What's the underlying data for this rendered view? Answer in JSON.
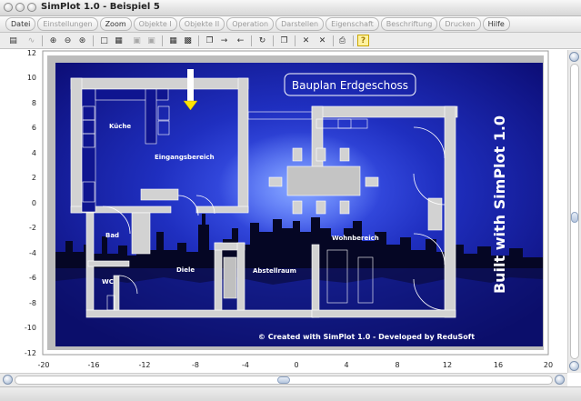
{
  "window": {
    "title": "SimPlot 1.0 - Beispiel 5"
  },
  "menu": {
    "items": [
      {
        "label": "Datei",
        "enabled": true
      },
      {
        "label": "Einstellungen",
        "enabled": false
      },
      {
        "label": "Zoom",
        "enabled": true
      },
      {
        "label": "Objekte I",
        "enabled": false
      },
      {
        "label": "Objekte II",
        "enabled": false
      },
      {
        "label": "Operation",
        "enabled": false
      },
      {
        "label": "Darstellen",
        "enabled": false
      },
      {
        "label": "Eigenschaft",
        "enabled": false
      },
      {
        "label": "Beschriftung",
        "enabled": false
      },
      {
        "label": "Drucken",
        "enabled": false
      },
      {
        "label": "Hilfe",
        "enabled": true
      }
    ]
  },
  "toolbar": {
    "buttons": [
      {
        "icon": "calculator-icon",
        "glyph": "▤"
      },
      {
        "icon": "curve-icon",
        "glyph": "∿",
        "disabled": true
      },
      {
        "icon": "zoom-in-icon",
        "glyph": "⊕"
      },
      {
        "icon": "zoom-out-icon",
        "glyph": "⊖"
      },
      {
        "icon": "zoom-fit-icon",
        "glyph": "⊛"
      },
      {
        "icon": "rectangle-icon",
        "glyph": "□"
      },
      {
        "icon": "grid-icon",
        "glyph": "▦"
      },
      {
        "icon": "frame-icon",
        "glyph": "▣",
        "disabled": true
      },
      {
        "icon": "frame-alt-icon",
        "glyph": "▣",
        "disabled": true
      },
      {
        "icon": "table-icon",
        "glyph": "▦"
      },
      {
        "icon": "image-icon",
        "glyph": "▩"
      },
      {
        "icon": "copy-icon",
        "glyph": "❐"
      },
      {
        "icon": "arrow-right-icon",
        "glyph": "→"
      },
      {
        "icon": "arrow-left-icon",
        "glyph": "←"
      },
      {
        "icon": "refresh-icon",
        "glyph": "↻"
      },
      {
        "icon": "duplicate-icon",
        "glyph": "❐"
      },
      {
        "icon": "delete-icon",
        "glyph": "✕"
      },
      {
        "icon": "delete-all-icon",
        "glyph": "✕"
      },
      {
        "icon": "print-icon",
        "glyph": "⎙"
      },
      {
        "icon": "help-icon",
        "glyph": "?"
      }
    ]
  },
  "plot": {
    "x_ticks": [
      "-20",
      "-16",
      "-12",
      "-8",
      "-4",
      "0",
      "4",
      "8",
      "12",
      "16",
      "20"
    ],
    "y_ticks": [
      "12",
      "10",
      "8",
      "6",
      "4",
      "2",
      "0",
      "-2",
      "-4",
      "-6",
      "-8",
      "-10",
      "-12"
    ],
    "banner_title": "Bauplan Erdgeschoss",
    "vertical_text": "Built with SimPlot 1.0",
    "footer_text": "© Created with SimPlot 1.0 - Developed by ReduSoft",
    "rooms": [
      "Küche",
      "Eingangsbereich",
      "Bad",
      "Diele",
      "WC",
      "Abstellraum",
      "Wohnbereich"
    ],
    "colors": {
      "background": "#0d0f7a",
      "glow": "#4a66ff",
      "wall": "#cfcfcf",
      "arrow": "#ffe400"
    }
  }
}
